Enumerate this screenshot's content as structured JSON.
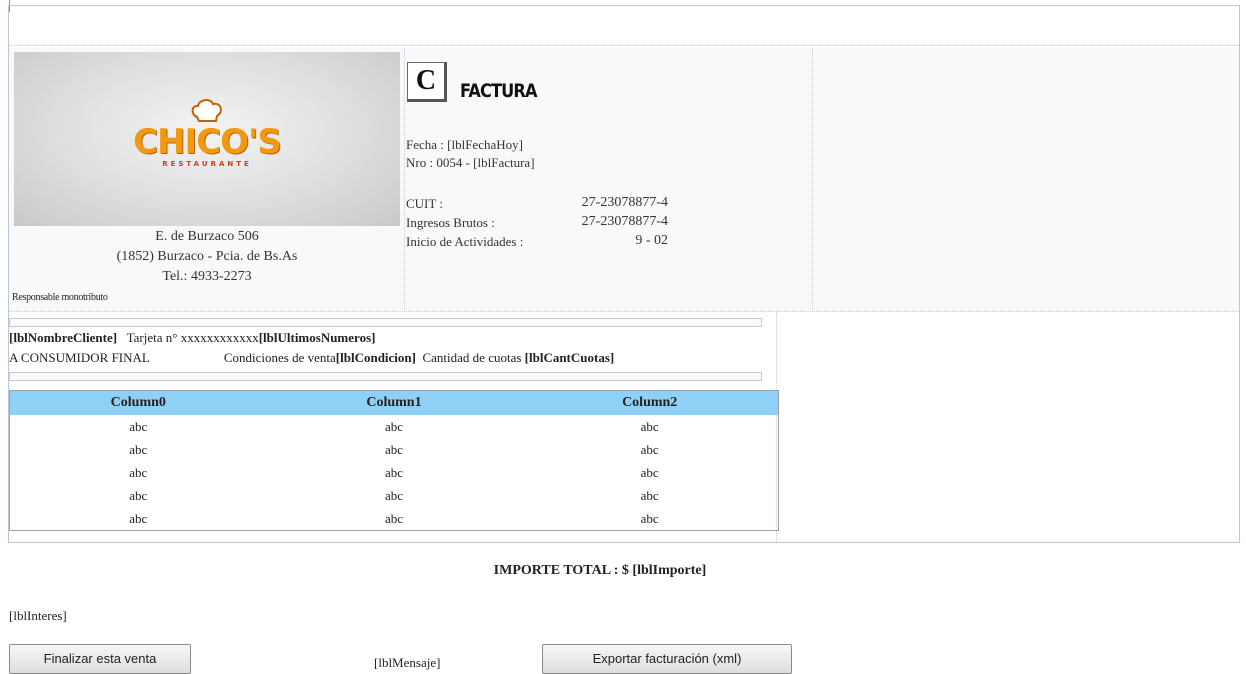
{
  "logo": {
    "name": "CHICO'S",
    "tagline": "RESTAURANTE"
  },
  "company": {
    "address": "E. de Burzaco 506",
    "city": "(1852) Burzaco - Pcia. de Bs.As",
    "phone": "Tel.: 4933-2273",
    "tax_status": "Responsable monotributo"
  },
  "invoice": {
    "letter": "C",
    "title": "FACTURA",
    "fecha": "Fecha : [lblFechaHoy]",
    "numero": "Nro : 0054 - [lblFactura]",
    "cuit_label": "CUIT :",
    "cuit_value": "27-23078877-4",
    "iibb_label": "Ingresos Brutos :",
    "iibb_value": "27-23078877-4",
    "inicio_label": "Inicio de Actividades :",
    "inicio_value": "9 - 02"
  },
  "client": {
    "nombre": "[lblNombreCliente]",
    "tarjeta_label": "Tarjeta n° xxxxxxxxxxxx",
    "ultimos": "[lblUltimosNumeros]",
    "consumidor": "A CONSUMIDOR FINAL",
    "condiciones_label": "Condiciones de venta",
    "condicion": "[lblCondicion]",
    "cuotas_label": "Cantidad de cuotas",
    "cant_cuotas": "[lblCantCuotas]"
  },
  "grid": {
    "columns": [
      "Column0",
      "Column1",
      "Column2"
    ],
    "rows": [
      [
        "abc",
        "abc",
        "abc"
      ],
      [
        "abc",
        "abc",
        "abc"
      ],
      [
        "abc",
        "abc",
        "abc"
      ],
      [
        "abc",
        "abc",
        "abc"
      ],
      [
        "abc",
        "abc",
        "abc"
      ]
    ]
  },
  "total": "IMPORTE TOTAL : $ [lblImporte]",
  "interes": "[lblInteres]",
  "buttons": {
    "finalizar": "Finalizar esta venta",
    "exportar": "Exportar facturación (xml)"
  },
  "mensaje": "[lblMensaje]",
  "colors": {
    "grid_header": "#8fd0f7",
    "logo_orange": "#f09a14",
    "logo_red": "#d43c1a"
  }
}
